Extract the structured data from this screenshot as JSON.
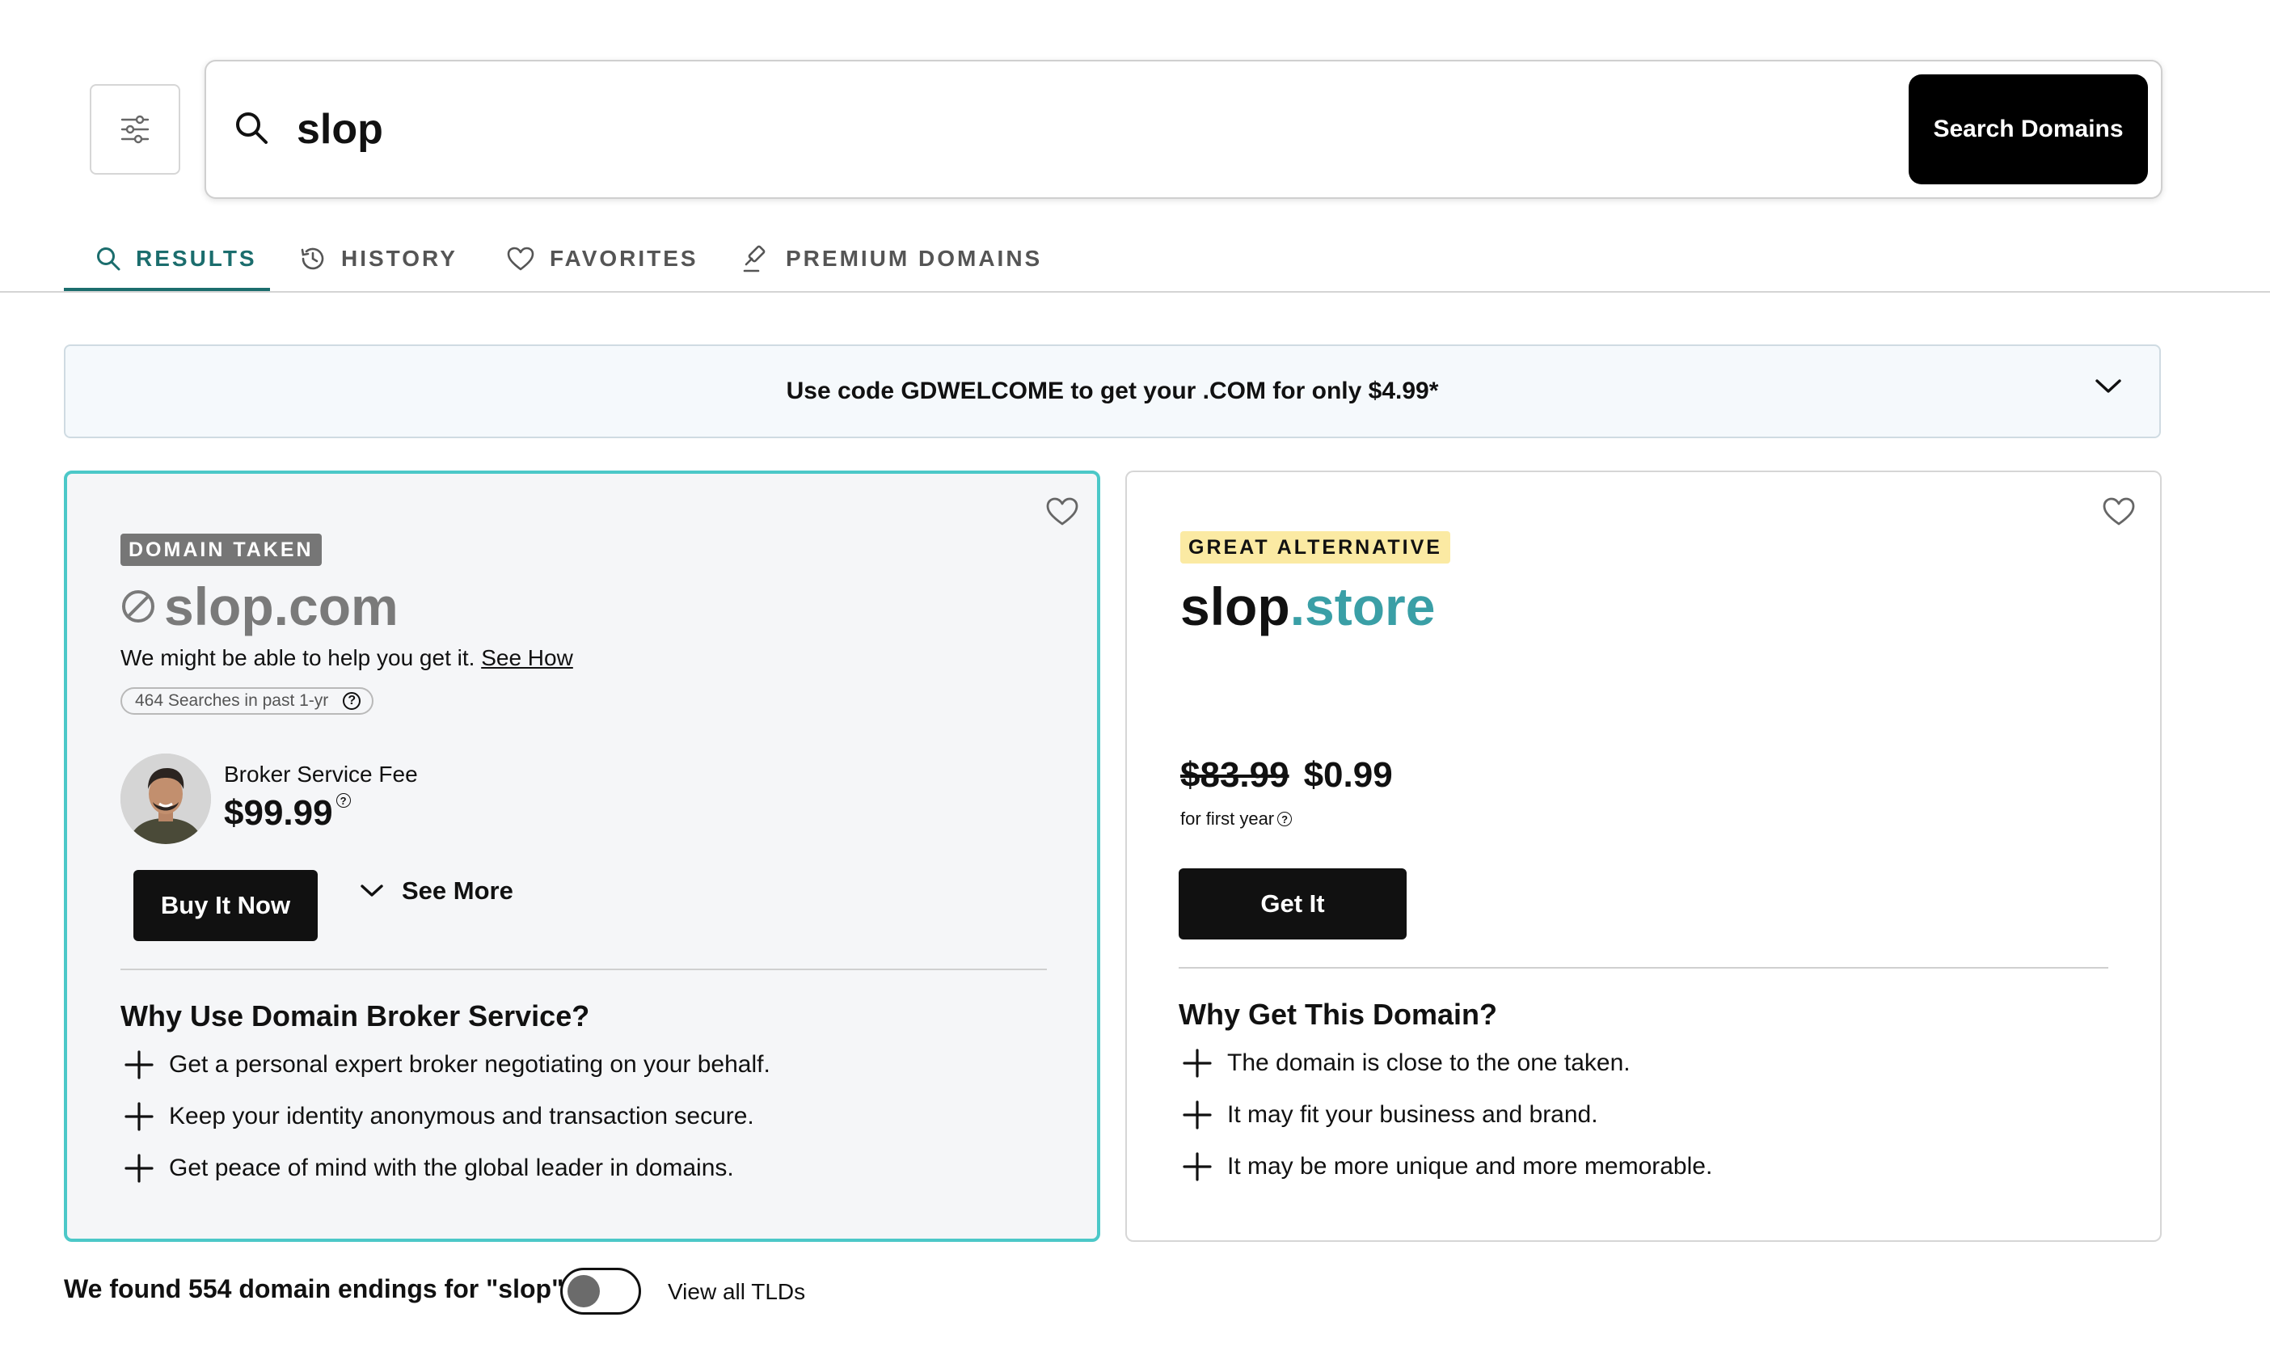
{
  "search": {
    "query": "slop",
    "button_label": "Search Domains"
  },
  "tabs": [
    {
      "label": "RESULTS",
      "icon": "search-icon",
      "active": true
    },
    {
      "label": "HISTORY",
      "icon": "history-icon",
      "active": false
    },
    {
      "label": "FAVORITES",
      "icon": "heart-icon",
      "active": false
    },
    {
      "label": "PREMIUM DOMAINS",
      "icon": "gavel-icon",
      "active": false
    }
  ],
  "promo": {
    "text": "Use code GDWELCOME to get your .COM for only $4.99*"
  },
  "taken_card": {
    "badge": "DOMAIN TAKEN",
    "domain": "slop.com",
    "help_text": "We might be able to help you get it.",
    "help_link": "See How",
    "searches": "464 Searches in past 1-yr",
    "fee_label": "Broker Service Fee",
    "fee_price": "$99.99",
    "buy_button": "Buy It Now",
    "see_more": "See More",
    "section_title": "Why Use Domain Broker Service?",
    "bullets": [
      "Get a personal expert broker negotiating on your behalf.",
      "Keep your identity anonymous and transaction secure.",
      "Get peace of mind with the global leader in domains."
    ]
  },
  "alt_card": {
    "badge": "GREAT ALTERNATIVE",
    "domain_name": "slop",
    "domain_tld": ".store",
    "old_price": "$83.99",
    "new_price": "$0.99",
    "price_note": "for first year",
    "button": "Get It",
    "section_title": "Why Get This Domain?",
    "bullets": [
      "The domain is close to the one taken.",
      "It may fit your business and brand.",
      "It may be more unique and more memorable."
    ]
  },
  "footer": {
    "found_text": "We found 554 domain endings for \"slop\"",
    "toggle_label": "View all TLDs",
    "toggle_on": false
  },
  "colors": {
    "accent": "#1b6d6d",
    "card_border": "#4cc8c8",
    "tld": "#3a9fa6",
    "badge_alt_bg": "#fbeaa3",
    "button_bg": "#111111"
  }
}
